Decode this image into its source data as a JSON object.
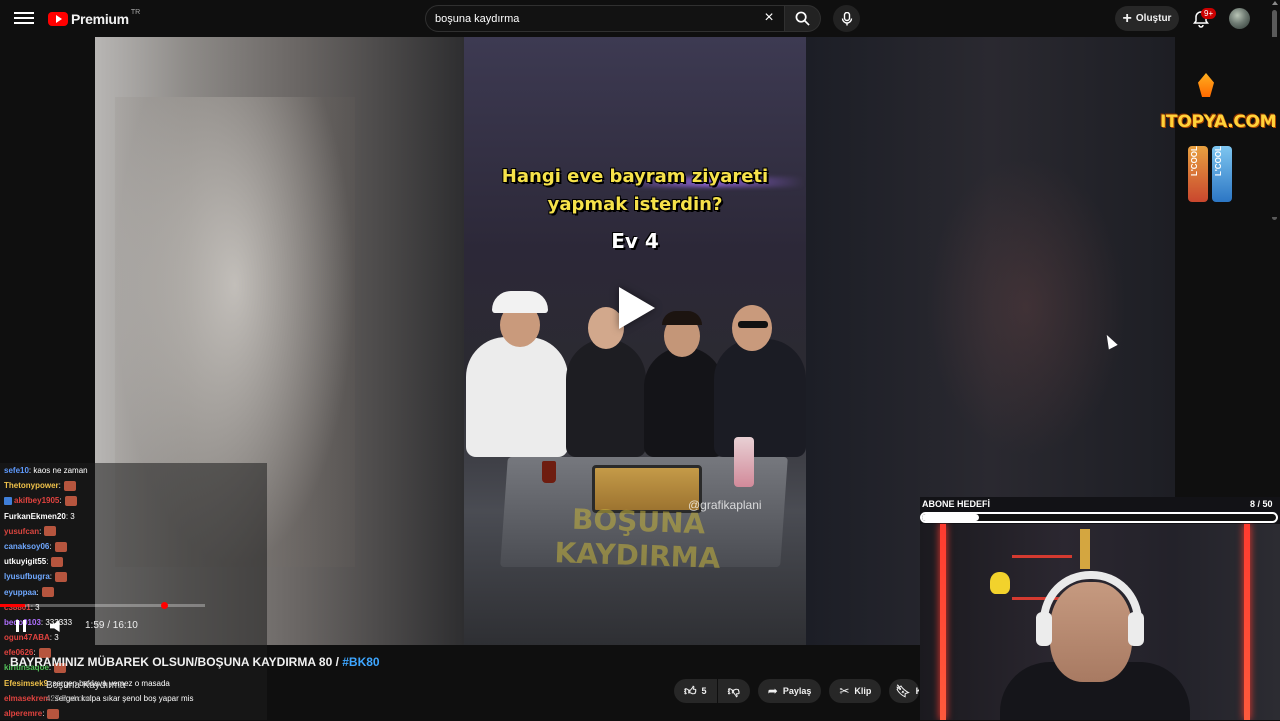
{
  "header": {
    "logo_text": "Premium",
    "logo_region": "TR",
    "search_value": "boşuna kaydırma",
    "create_label": "Oluştur",
    "notification_count": "9+"
  },
  "video_frame": {
    "question": "Hangi eve bayram ziyareti yapmak isterdin?",
    "episode": "Ev 4",
    "watermark": "BOŞUNA KAYDIRMA",
    "handle": "@grafikaplani"
  },
  "sponsor": {
    "name": "ITOPYA.COM",
    "can_label": "L'COOL"
  },
  "player": {
    "time_current": "1:59",
    "time_total": "16:10",
    "time_display": "1:59 / 16:10",
    "progress_fraction": 0.123
  },
  "video": {
    "title": "BAYRAMINIZ MÜBAREK OLSUN/BOŞUNA KAYDIRMA 80 / ",
    "hashtag": "#BK80",
    "channel": "Boşuna Kaydırma",
    "subscribers": "427 B abone"
  },
  "actions": {
    "like_count": "5",
    "share_label": "Paylaş",
    "clip_label": "Klip",
    "save_label": "Ka"
  },
  "goal": {
    "label": "ABONE HEDEFİ",
    "count": "8 / 50",
    "fraction": 0.16
  },
  "chat": [
    {
      "user": "sefe10",
      "msg": ": kaos ne zaman",
      "color": "#5f9bff"
    },
    {
      "user": "Thetonypower",
      "msg": ":",
      "color": "#f0c24a",
      "emote": true
    },
    {
      "user": "akifbey1905",
      "msg": ":",
      "color": "#e0433f",
      "emote": true,
      "badge": true
    },
    {
      "user": "FurkanEkmen20",
      "msg": ": 3",
      "color": "#ffffff"
    },
    {
      "user": "yusufcan",
      "msg": ":",
      "color": "#d9453f",
      "emote": true
    },
    {
      "user": "canaksoy06",
      "msg": ":",
      "color": "#6fa8ff",
      "emote": true
    },
    {
      "user": "utkuyigit55",
      "msg": ":",
      "color": "#ffffff",
      "emote": true
    },
    {
      "user": "lyusufbugra",
      "msg": ":",
      "color": "#6fa8ff",
      "emote": true
    },
    {
      "user": "eyuppaa",
      "msg": ":",
      "color": "#6fa8ff",
      "emote": true
    },
    {
      "user": "c38801",
      "msg": ": 3",
      "color": "#e0433f"
    },
    {
      "user": "bedo0103",
      "msg": ": 333333",
      "color": "#b070ff"
    },
    {
      "user": "ogun47ABA",
      "msg": ": 3",
      "color": "#e0433f"
    },
    {
      "user": "efe0626",
      "msg": ":",
      "color": "#e0433f",
      "emote": true
    },
    {
      "user": "kiritinsaqoe",
      "msg": ":",
      "color": "#53c05a",
      "emote": true
    },
    {
      "user": "Efesimsek9",
      "msg": ": sergen baklava yemez o masada",
      "color": "#f0c24a"
    },
    {
      "user": "elmasekrem",
      "msg": ": sergen kolpa sıkar şenol boş yapar mis",
      "color": "#e0433f"
    },
    {
      "user": "alperemre",
      "msg": ":",
      "color": "#e0433f",
      "emote": true
    }
  ]
}
